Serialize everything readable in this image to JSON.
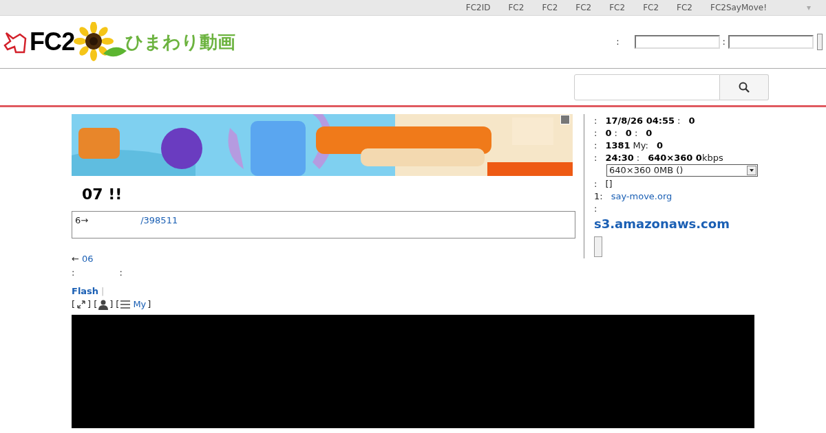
{
  "top_nav": {
    "links": [
      "FC2ID",
      "FC2",
      "FC2",
      "FC2",
      "FC2",
      "FC2",
      "FC2",
      "FC2SayMove!"
    ],
    "dropdown": "▾"
  },
  "header": {
    "logo": {
      "brand": "FC2",
      "site": "ひまわり動画"
    },
    "login": {
      "label1": ":",
      "label2": ":"
    }
  },
  "banner": {
    "kind": "picture"
  },
  "title": "07 !!",
  "description": {
    "prefix": "6→",
    "link": "/398511"
  },
  "prev": {
    "arrow": "←",
    "link": "06"
  },
  "meta_line": [
    ":",
    ":"
  ],
  "player_links": {
    "flash": "Flash",
    "separator": "|"
  },
  "player_tools": [
    {
      "kind": "expand",
      "open": "[",
      "close": "]"
    },
    {
      "kind": "user",
      "open": "[",
      "close": "]"
    },
    {
      "kind": "list",
      "open": "[",
      "close": "]",
      "label": "My"
    }
  ],
  "info_rows": [
    [
      {
        "text": ":",
        "kind": "plain"
      },
      {
        "text": "17/8/26 04:55",
        "kind": "bold"
      },
      {
        "text": ":",
        "kind": "plain"
      },
      {
        "text": "0",
        "kind": "bold"
      }
    ],
    [
      {
        "text": ":",
        "kind": "plain"
      },
      {
        "text": "0",
        "kind": "bold"
      },
      {
        "text": ":",
        "kind": "plain"
      },
      {
        "text": "0",
        "kind": "bold"
      },
      {
        "text": ":",
        "kind": "plain"
      },
      {
        "text": "0",
        "kind": "bold"
      }
    ],
    [
      {
        "text": ":",
        "kind": "plain"
      },
      {
        "text": "1381",
        "kind": "bold"
      },
      {
        "text": "My:",
        "kind": "plain"
      },
      {
        "text": "0",
        "kind": "bold"
      }
    ],
    [
      {
        "text": ":",
        "kind": "plain"
      },
      {
        "text": "24:30",
        "kind": "bold"
      },
      {
        "text": ":",
        "kind": "plain"
      },
      {
        "text": "640×360 0",
        "kind": "bold"
      },
      {
        "text": "kbps",
        "kind": "tight"
      }
    ]
  ],
  "quality_select": "640×360 0MB ()",
  "info_rows2": [
    [
      {
        "text": ":",
        "kind": "plain"
      },
      {
        "text": "[]",
        "kind": "plain"
      }
    ],
    [
      {
        "text": "1:",
        "kind": "plain"
      },
      {
        "text": "say-move.org",
        "kind": "link"
      }
    ],
    [
      {
        "text": ":",
        "kind": "plain"
      }
    ]
  ],
  "source_link": "s3.amazonaws.com"
}
